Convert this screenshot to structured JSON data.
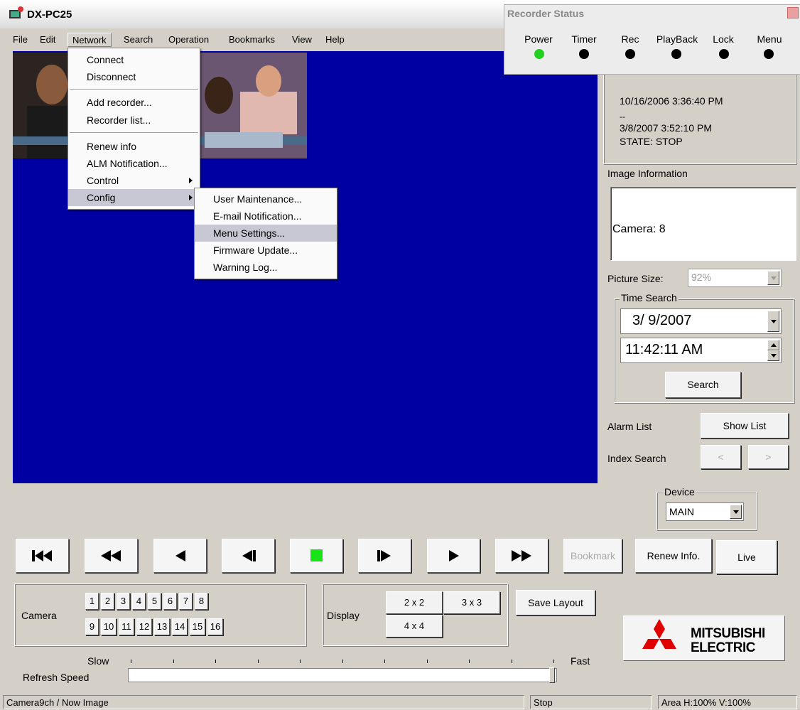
{
  "window": {
    "title": "DX-PC25"
  },
  "menubar": [
    "File",
    "Edit",
    "Network",
    "Search",
    "Operation",
    "Bookmarks",
    "View",
    "Help"
  ],
  "network_menu": {
    "items": [
      "Connect",
      "Disconnect",
      "Add recorder...",
      "Recorder list...",
      "Renew info",
      "ALM Notification...",
      "Control",
      "Config"
    ]
  },
  "config_submenu": {
    "items": [
      "User Maintenance...",
      "E-mail Notification...",
      "Menu Settings...",
      "Firmware Update...",
      "Warning Log..."
    ],
    "highlighted": "Menu Settings..."
  },
  "recorder_status": {
    "title": "Recorder Status",
    "indicators": [
      {
        "label": "Power",
        "color": "#22d022"
      },
      {
        "label": "Timer",
        "color": "#000000"
      },
      {
        "label": "Rec",
        "color": "#000000"
      },
      {
        "label": "PlayBack",
        "color": "#000000"
      },
      {
        "label": "Lock",
        "color": "#000000"
      },
      {
        "label": "Menu",
        "color": "#000000"
      }
    ]
  },
  "recorder_info": {
    "start": "10/16/2006 3:36:40 PM",
    "dash": "--",
    "end": "3/8/2007 3:52:10 PM",
    "state": "STATE: STOP"
  },
  "image_information": {
    "label": "Image Information",
    "camera": "Camera: 8"
  },
  "picture_size": {
    "label": "Picture Size:",
    "value": "92%"
  },
  "time_search": {
    "label": "Time Search",
    "date": "3/ 9/2007",
    "time": "11:42:11 AM",
    "search_button": "Search"
  },
  "alarm_list": {
    "label": "Alarm List",
    "button": "Show List"
  },
  "index_search": {
    "label": "Index Search",
    "prev": "<",
    "next": ">"
  },
  "device": {
    "label": "Device",
    "value": "MAIN"
  },
  "transport": {
    "bookmark": "Bookmark",
    "renew": "Renew Info.",
    "live": "Live",
    "stop_color": "#17e317"
  },
  "camera": {
    "label": "Camera",
    "row1": [
      "1",
      "2",
      "3",
      "4",
      "5",
      "6",
      "7",
      "8"
    ],
    "row2": [
      "9",
      "10",
      "11",
      "12",
      "13",
      "14",
      "15",
      "16"
    ]
  },
  "display": {
    "label": "Display",
    "b2x2": "2 x 2",
    "b3x3": "3 x 3",
    "b4x4": "4 x 4"
  },
  "save_layout": "Save Layout",
  "refresh_speed": {
    "label": "Refresh Speed",
    "slow": "Slow",
    "fast": "Fast",
    "value_fraction": 1.0
  },
  "logo": {
    "line1": "MITSUBISHI",
    "line2": "ELECTRIC",
    "color": "#e00000"
  },
  "statusbar": {
    "left": "Camera9ch / Now Image",
    "middle": "Stop",
    "right": "Area H:100% V:100%"
  },
  "colors": {
    "video_background": "#0000a2"
  }
}
